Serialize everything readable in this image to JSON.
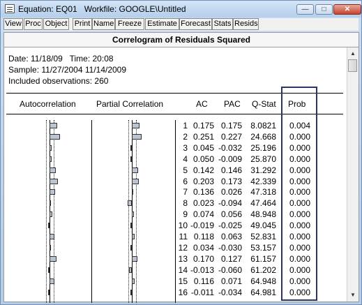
{
  "window": {
    "title": "Equation: EQ01   Workfile: GOOGLE\\Untitled",
    "minimize": "—",
    "maximize": "□",
    "close": "✕"
  },
  "toolbar": {
    "buttons": [
      "View",
      "Proc",
      "Object",
      "Print",
      "Name",
      "Freeze",
      "Estimate",
      "Forecast",
      "Stats",
      "Resids"
    ]
  },
  "view": {
    "title": "Correlogram of Residuals Squared",
    "date_line": "Date: 11/18/09   Time: 20:08",
    "sample_line": "Sample: 11/27/2004 11/14/2009",
    "obs_line": "Included observations: 260",
    "headers": {
      "autocorrelation": "Autocorrelation",
      "partial_correlation": "Partial Correlation",
      "ac": "AC",
      "pac": "PAC",
      "qstat": "Q-Stat",
      "prob": "Prob"
    },
    "rows": [
      {
        "lag": "1",
        "ac": "0.175",
        "pac": "0.175",
        "q": "8.0821",
        "prob": "0.004"
      },
      {
        "lag": "2",
        "ac": "0.251",
        "pac": "0.227",
        "q": "24.668",
        "prob": "0.000"
      },
      {
        "lag": "3",
        "ac": "0.045",
        "pac": "-0.032",
        "q": "25.196",
        "prob": "0.000"
      },
      {
        "lag": "4",
        "ac": "0.050",
        "pac": "-0.009",
        "q": "25.870",
        "prob": "0.000"
      },
      {
        "lag": "5",
        "ac": "0.142",
        "pac": "0.146",
        "q": "31.292",
        "prob": "0.000"
      },
      {
        "lag": "6",
        "ac": "0.203",
        "pac": "0.173",
        "q": "42.339",
        "prob": "0.000"
      },
      {
        "lag": "7",
        "ac": "0.136",
        "pac": "0.026",
        "q": "47.318",
        "prob": "0.000"
      },
      {
        "lag": "8",
        "ac": "0.023",
        "pac": "-0.094",
        "q": "47.464",
        "prob": "0.000"
      },
      {
        "lag": "9",
        "ac": "0.074",
        "pac": "0.056",
        "q": "48.948",
        "prob": "0.000"
      },
      {
        "lag": "10",
        "ac": "-0.019",
        "pac": "-0.025",
        "q": "49.045",
        "prob": "0.000"
      },
      {
        "lag": "11",
        "ac": "0.118",
        "pac": "0.063",
        "q": "52.831",
        "prob": "0.000"
      },
      {
        "lag": "12",
        "ac": "0.034",
        "pac": "-0.030",
        "q": "53.157",
        "prob": "0.000"
      },
      {
        "lag": "13",
        "ac": "0.170",
        "pac": "0.127",
        "q": "61.157",
        "prob": "0.000"
      },
      {
        "lag": "14",
        "ac": "-0.013",
        "pac": "-0.060",
        "q": "61.202",
        "prob": "0.000"
      },
      {
        "lag": "15",
        "ac": "0.116",
        "pac": "0.071",
        "q": "64.948",
        "prob": "0.000"
      },
      {
        "lag": "16",
        "ac": "-0.011",
        "pac": "-0.034",
        "q": "64.981",
        "prob": "0.000"
      }
    ]
  },
  "colors": {
    "bar_fill": "#bcc4d4",
    "highlight_border": "#2a3566",
    "title_bar": "#c2d8f0"
  }
}
